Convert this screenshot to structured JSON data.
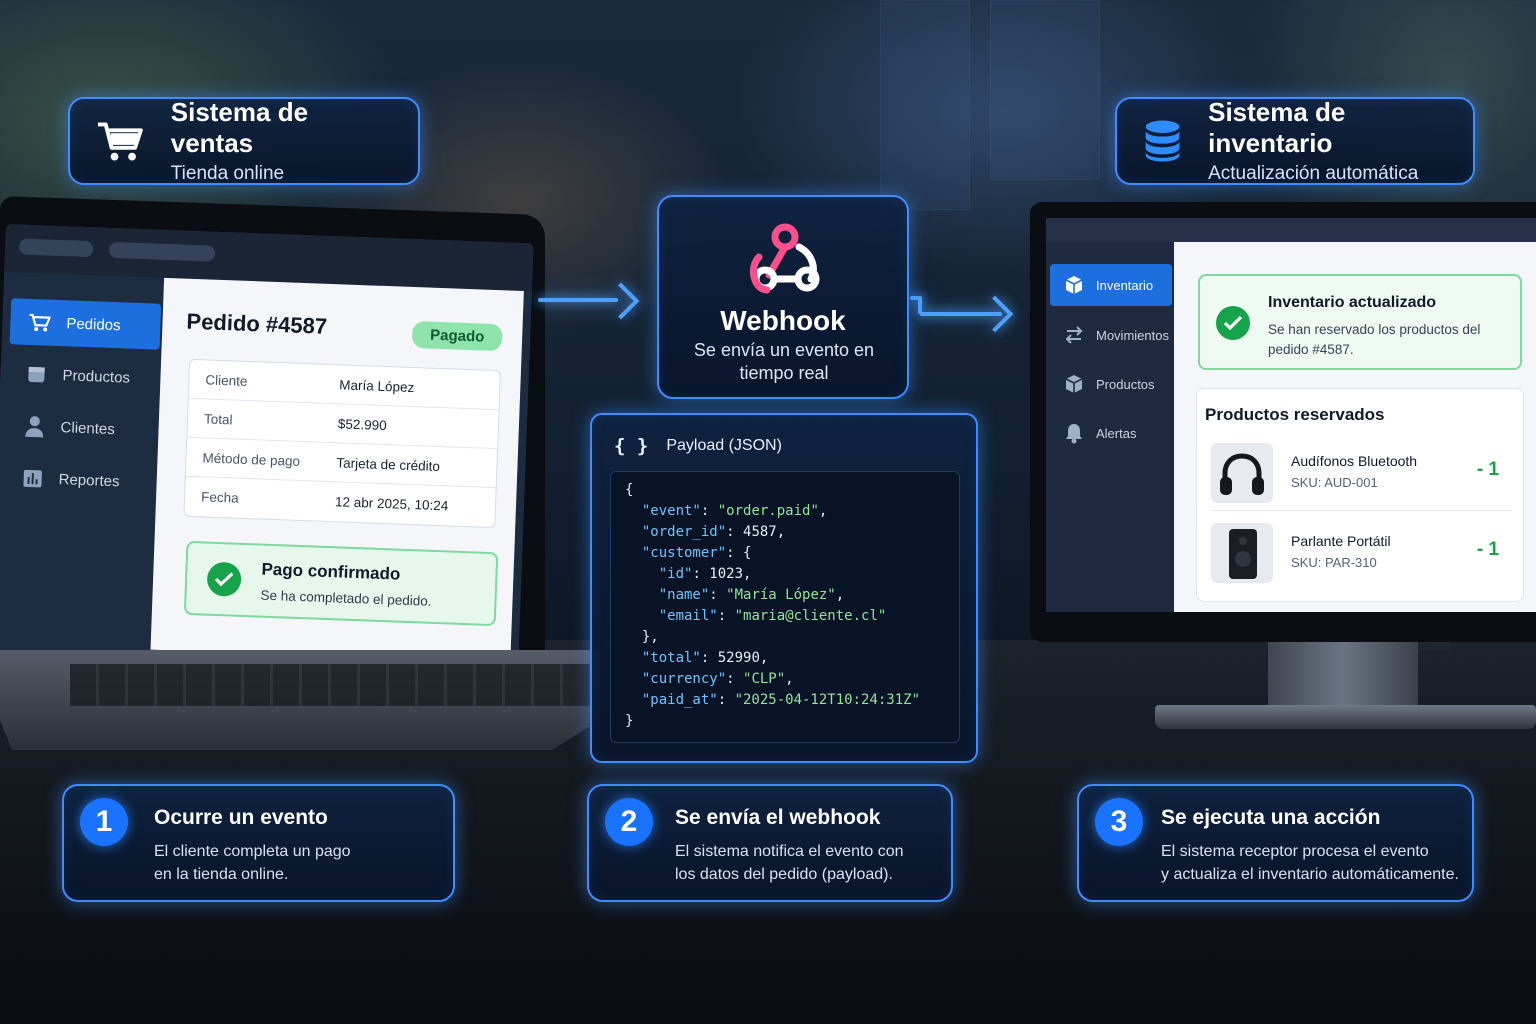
{
  "sales_header": {
    "title": "Sistema de ventas",
    "subtitle": "Tienda online",
    "icon": "cart-icon"
  },
  "inventory_header": {
    "title": "Sistema de inventario",
    "subtitle": "Actualización automática",
    "icon": "database-icon"
  },
  "webhook": {
    "title": "Webhook",
    "subtitle": "Se envía un evento en tiempo real",
    "icon": "webhook-icon"
  },
  "laptop": {
    "nav": [
      {
        "label": "Pedidos",
        "icon": "cart-icon",
        "active": true
      },
      {
        "label": "Productos",
        "icon": "box-icon",
        "active": false
      },
      {
        "label": "Clientes",
        "icon": "user-icon",
        "active": false
      },
      {
        "label": "Reportes",
        "icon": "chart-icon",
        "active": false
      }
    ],
    "order_title": "Pedido #4587",
    "status_badge": "Pagado",
    "rows": [
      {
        "key": "Cliente",
        "value": "María López"
      },
      {
        "key": "Total",
        "value": "$52.990"
      },
      {
        "key": "Método de pago",
        "value": "Tarjeta de crédito"
      },
      {
        "key": "Fecha",
        "value": "12 abr 2025, 10:24"
      }
    ],
    "confirm_title": "Pago confirmado",
    "confirm_sub": "Se ha completado el pedido."
  },
  "payload": {
    "title": "Payload (JSON)",
    "icon": "braces-icon",
    "lines": [
      {
        "t": "{"
      },
      {
        "k": "\"event\"",
        "v": "\"order.paid\"",
        "str": true,
        "indent": 1,
        "end": ","
      },
      {
        "k": "\"order_id\"",
        "v": "4587",
        "str": false,
        "indent": 1,
        "end": ","
      },
      {
        "k": "\"customer\"",
        "v": "{",
        "str": false,
        "indent": 1,
        "end": ""
      },
      {
        "k": "\"id\"",
        "v": "1023",
        "str": false,
        "indent": 2,
        "end": ","
      },
      {
        "k": "\"name\"",
        "v": "\"María López\"",
        "str": true,
        "indent": 2,
        "end": ","
      },
      {
        "k": "\"email\"",
        "v": "\"maria@cliente.cl\"",
        "str": true,
        "indent": 2,
        "end": ""
      },
      {
        "t": "  },"
      },
      {
        "k": "\"total\"",
        "v": "52990",
        "str": false,
        "indent": 1,
        "end": ","
      },
      {
        "k": "\"currency\"",
        "v": "\"CLP\"",
        "str": true,
        "indent": 1,
        "end": ","
      },
      {
        "k": "\"paid_at\"",
        "v": "\"2025-04-12T10:24:31Z\"",
        "str": true,
        "indent": 1,
        "end": ""
      },
      {
        "t": "}"
      }
    ]
  },
  "monitor": {
    "nav": [
      {
        "label": "Inventario",
        "icon": "cube-icon",
        "active": true
      },
      {
        "label": "Movimientos",
        "icon": "transfer-icon",
        "active": false
      },
      {
        "label": "Productos",
        "icon": "boxes-icon",
        "active": false
      },
      {
        "label": "Alertas",
        "icon": "bell-icon",
        "active": false
      }
    ],
    "updated_title": "Inventario actualizado",
    "updated_sub": "Se han reservado los productos del pedido #4587.",
    "products_title": "Productos reservados",
    "products": [
      {
        "name": "Audífonos Bluetooth",
        "sku": "SKU: AUD-001",
        "qty": "- 1",
        "icon": "headphones-icon"
      },
      {
        "name": "Parlante Portátil",
        "sku": "SKU: PAR-310",
        "qty": "- 1",
        "icon": "speaker-icon"
      }
    ]
  },
  "steps": [
    {
      "num": "1",
      "title": "Ocurre un evento",
      "text": "El cliente completa un pago\nen la tienda online."
    },
    {
      "num": "2",
      "title": "Se envía el webhook",
      "text": "El sistema notifica el evento con\nlos datos del pedido (payload)."
    },
    {
      "num": "3",
      "title": "Se ejecuta una acción",
      "text": "El sistema receptor procesa el evento\ny actualiza el inventario automáticamente."
    }
  ],
  "colors": {
    "accent": "#3f8cff",
    "success": "#17a34a",
    "active_nav": "#1d6fe0"
  }
}
